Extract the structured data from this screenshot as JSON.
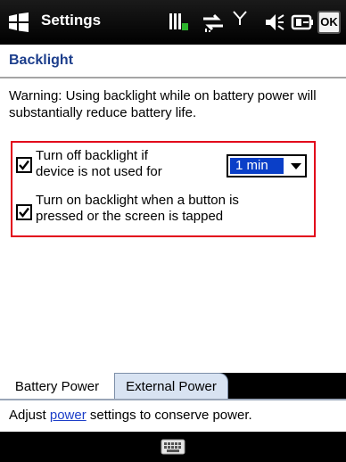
{
  "titlebar": {
    "title": "Settings",
    "ok_label": "OK",
    "icons": [
      "windows-start-icon",
      "battery-charging-icon",
      "connectivity-icon",
      "signal-icon",
      "volume-icon",
      "battery-level-icon"
    ]
  },
  "page": {
    "title": "Backlight"
  },
  "warning": "Warning: Using backlight while on battery power will substantially reduce battery life.",
  "options": {
    "turn_off": {
      "label_line1": "Turn off backlight if",
      "label_line2": "device is not used for",
      "checked": true,
      "timeout_value": "1 min"
    },
    "turn_on": {
      "label_line1": "Turn on backlight when a button is",
      "label_line2": "pressed or the screen is tapped",
      "checked": true
    }
  },
  "tabs": [
    {
      "label": "Battery Power",
      "active": true
    },
    {
      "label": "External Power",
      "active": false
    }
  ],
  "footer": {
    "prefix": "Adjust ",
    "link": "power",
    "suffix": " settings to conserve power."
  },
  "colors": {
    "highlight_border": "#e2001a",
    "selection": "#0a3fc8",
    "link": "#1c3ec8"
  }
}
